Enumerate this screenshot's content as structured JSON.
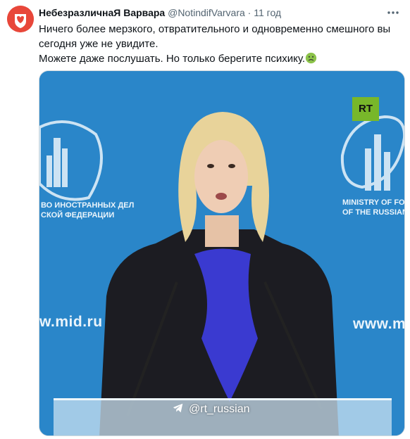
{
  "tweet": {
    "display_name": "НебезразличнаЯ Варвара",
    "handle": "@NotindifVarvara",
    "separator": "·",
    "time": "11 год",
    "more_icon": "more-horizontal-icon",
    "text_line1": "Ничего более мерзкого, отвратительного и одновременно смешного вы сегодня уже не увидите.",
    "text_line2": "Можете даже послушать. Но только берегите психику.",
    "emoji": "nauseated-face-emoji"
  },
  "media": {
    "channel_logo": "RT",
    "left_wall_text": "w.mid.ru",
    "right_wall_text": "www.m",
    "left_ministry_line1": "ВО ИНОСТРАННЫХ ДЕЛ",
    "left_ministry_line2": "СКОЙ ФЕДЕРАЦИИ",
    "right_ministry_line1": "MINISTRY OF FOR",
    "right_ministry_line2": "OF THE RUSSIAN",
    "watermark": "@rt_russian",
    "colors": {
      "backdrop": "#2a86c9",
      "blouse": "#1c1c22",
      "bow": "#3a3ad0",
      "hair": "#e8d39a"
    }
  }
}
